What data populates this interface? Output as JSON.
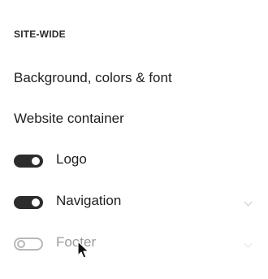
{
  "section": {
    "title": "SITE-WIDE"
  },
  "links": {
    "background": "Background, colors & font",
    "website_container": "Website container"
  },
  "toggles": [
    {
      "label": "Logo",
      "enabled": true,
      "has_chevron": false
    },
    {
      "label": "Navigation",
      "enabled": true,
      "has_chevron": true
    },
    {
      "label": "Footer",
      "enabled": false,
      "has_chevron": true
    }
  ],
  "icons": {
    "chevron": "chevron-down-icon",
    "cursor": "mouse-pointer-icon"
  },
  "colors": {
    "toggle_on": "#2c2c2c",
    "toggle_off_border": "#b8b8b8",
    "disabled_text": "#9b9b9b"
  }
}
